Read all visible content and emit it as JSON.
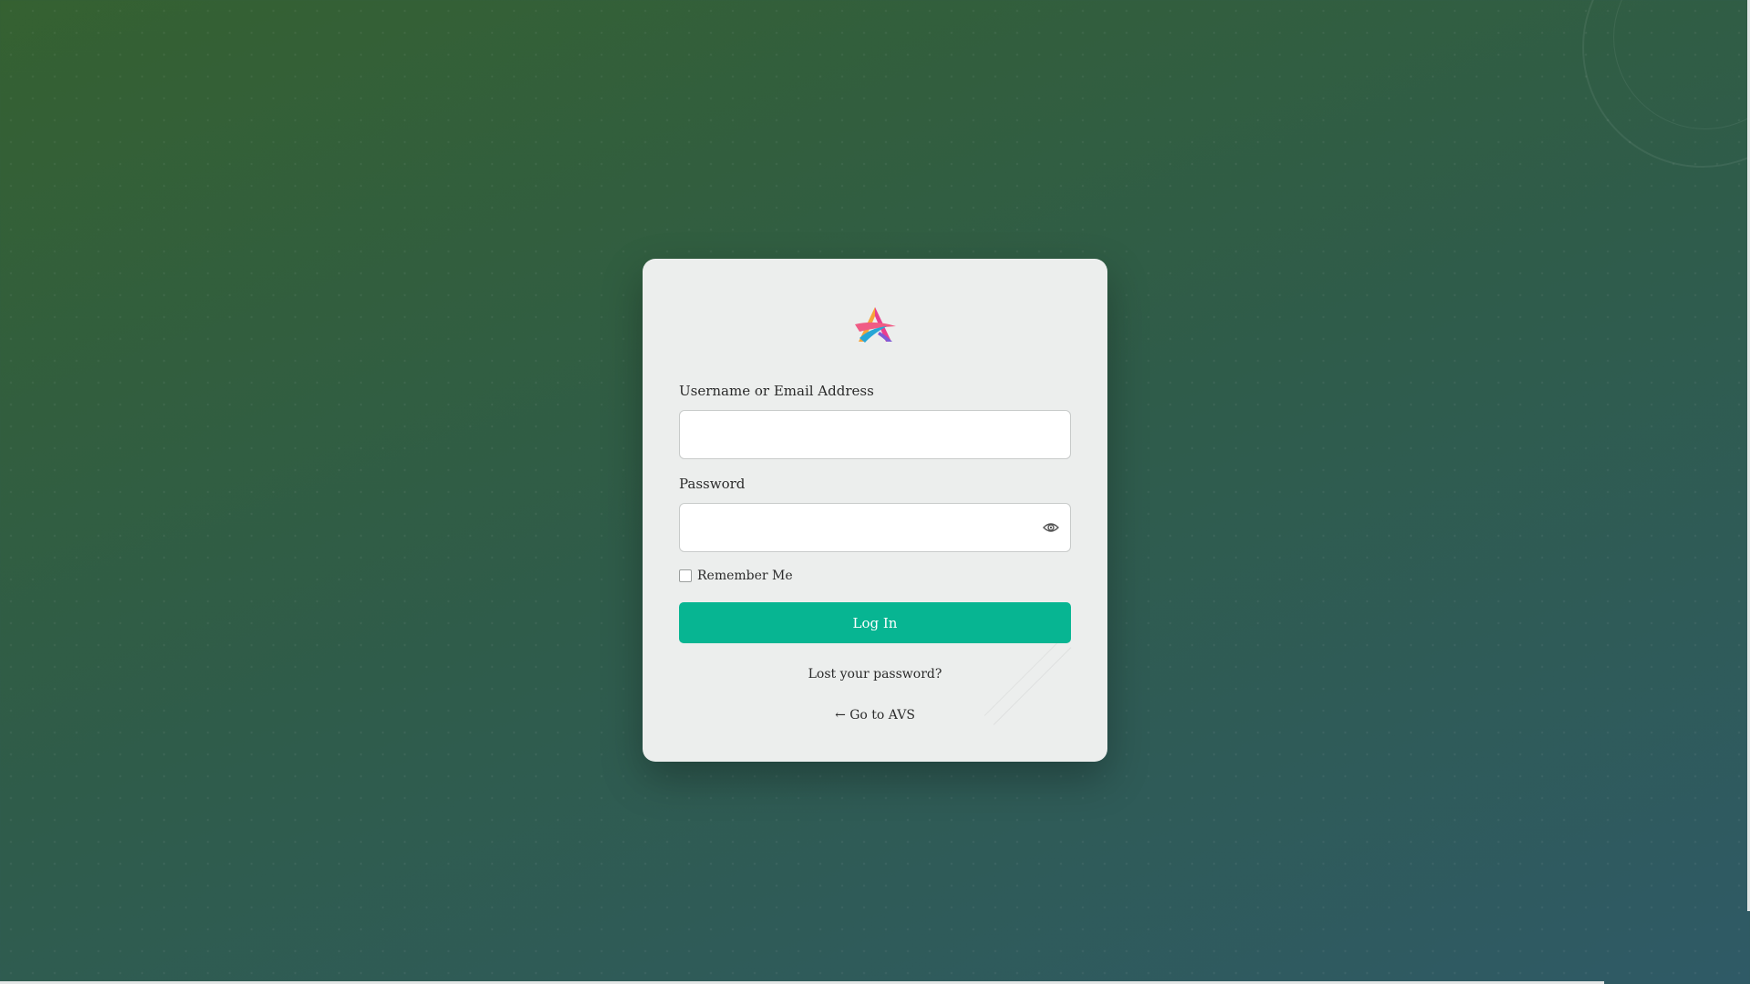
{
  "login_form": {
    "username_label": "Username or Email Address",
    "username_value": "",
    "password_label": "Password",
    "password_value": "",
    "remember_label": "Remember Me",
    "remember_checked": false,
    "submit_label": "Log In"
  },
  "links": {
    "lost_password": "Lost your password?",
    "back_to_site": "← Go to AVS"
  },
  "icons": {
    "logo": "site-logo-icon",
    "password_toggle": "eye-icon"
  },
  "colors": {
    "accent": "#07b592",
    "card_background": "#eceeed",
    "page_background_start": "#356131",
    "page_background_end": "#2f5a66"
  }
}
